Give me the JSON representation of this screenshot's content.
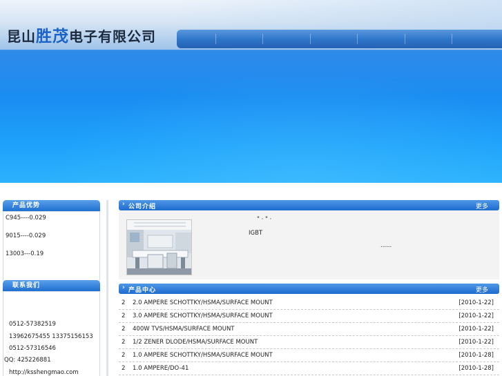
{
  "header": {
    "company_prefix": "昆山",
    "company_accent": "胜茂",
    "company_suffix": "电子有限公司"
  },
  "sidebar": {
    "advantage_title": "产品优势",
    "advantage_items": [
      "C945----0.029",
      "9015----0.029",
      "13003---0.19"
    ],
    "contact_title": "联系我们",
    "contact_lines": [
      "0512-57382519",
      "13962675455 13375156153",
      "0512-57316546",
      "QQ: 425226881",
      "http://ksshengmao.com"
    ]
  },
  "about": {
    "title": "公司介绍",
    "more": "更多",
    "text_line1": "\"    ·    \"          ·",
    "text_line2": "IGBT",
    "text_line3": "......"
  },
  "products": {
    "title": "产品中心",
    "more": "更多",
    "items": [
      {
        "num": "2",
        "name": "2.0 AMPERE SCHOTTKY/HSMA/SURFACE MOUNT",
        "date": "[2010-1-22]"
      },
      {
        "num": "2",
        "name": "3.0 AMPERE SCHOTTKY/HSMA/SURFACE MOUNT",
        "date": "[2010-1-22]"
      },
      {
        "num": "2",
        "name": "400W TVS/HSMA/SURFACE MOUNT",
        "date": "[2010-1-22]"
      },
      {
        "num": "2",
        "name": "1/2 ZENER DLODE/HSMA/SURFACE MOUNT",
        "date": "[2010-1-22]"
      },
      {
        "num": "2",
        "name": "1.0 AMPERE SCHOTTKY/HSMA/SURFACE MOUNT",
        "date": "[2010-1-28]"
      },
      {
        "num": "2",
        "name": "1.0 AMPERE/DO-41",
        "date": "[2010-1-28]"
      }
    ]
  }
}
